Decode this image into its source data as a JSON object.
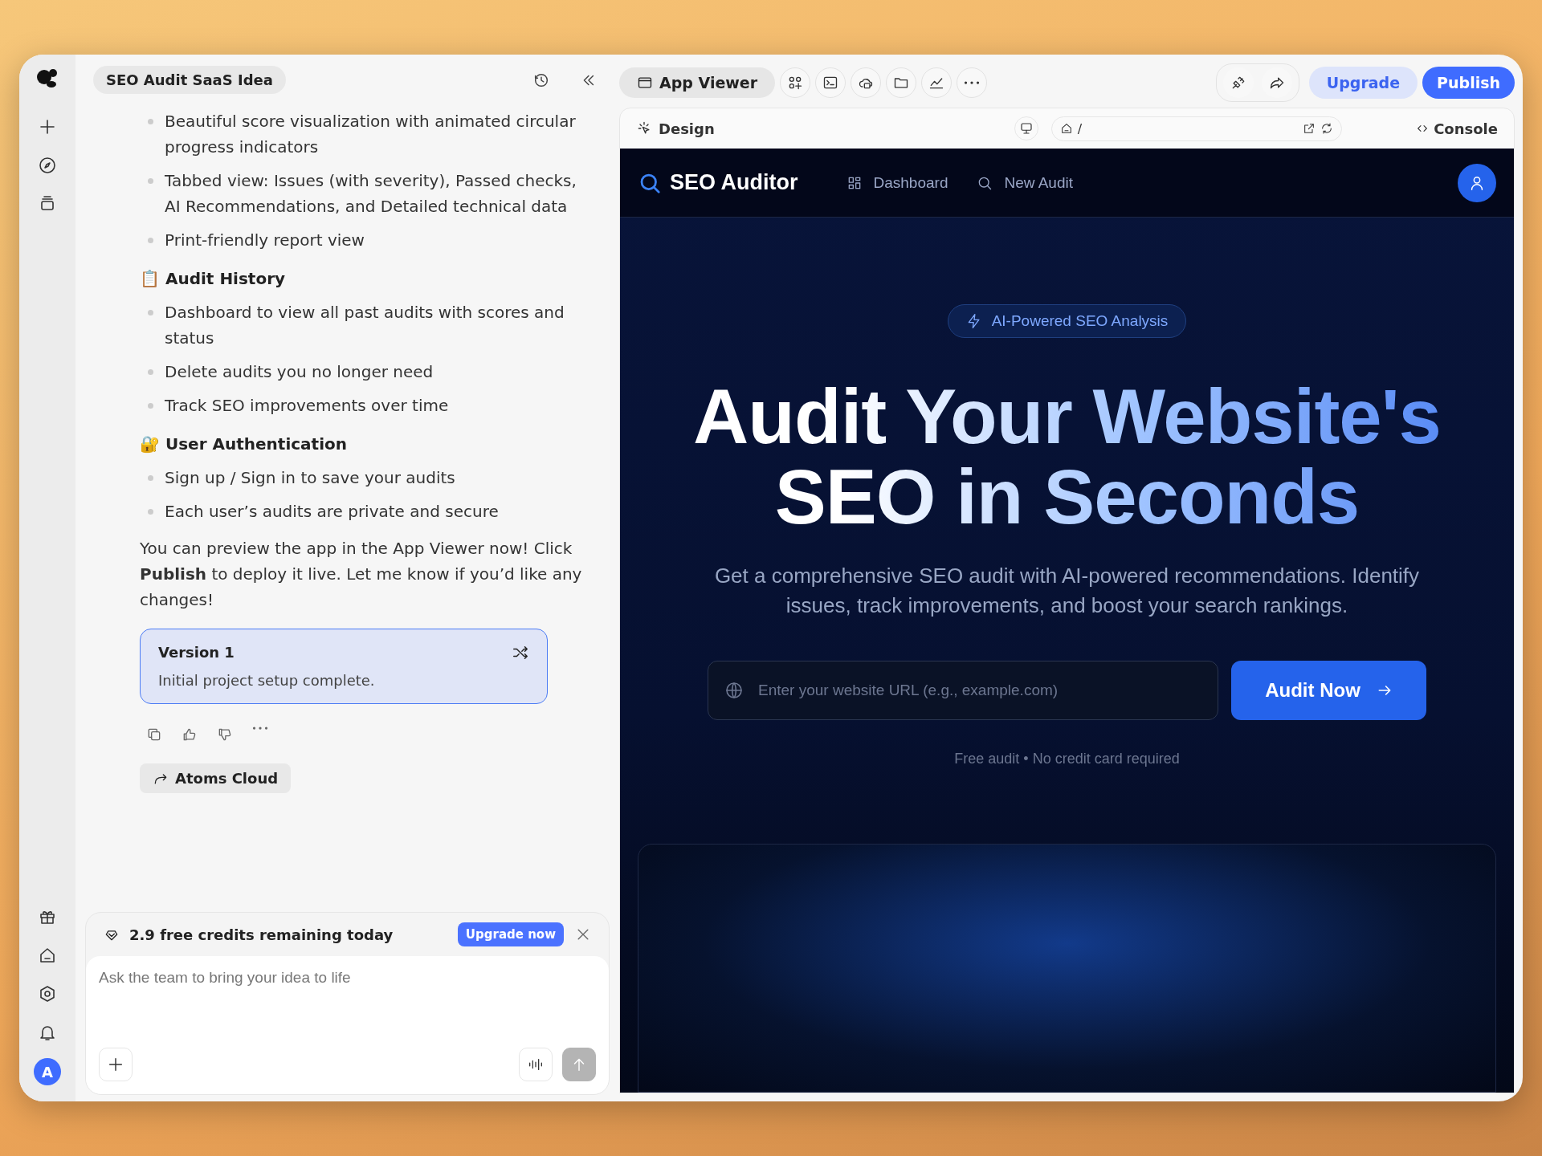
{
  "chat": {
    "title": "SEO Audit SaaS Idea",
    "blocks": [
      {
        "kind": "bullet",
        "text": "Beautiful score visualization with animated circular progress indicators"
      },
      {
        "kind": "bullet",
        "text": "Tabbed view: Issues (with severity), Passed checks, AI Recommendations, and Detailed technical data"
      },
      {
        "kind": "bullet",
        "text": "Print-friendly report view"
      },
      {
        "kind": "heading",
        "text": "📋 Audit History"
      },
      {
        "kind": "bullet",
        "text": "Dashboard to view all past audits with scores and status"
      },
      {
        "kind": "bullet",
        "text": "Delete audits you no longer need"
      },
      {
        "kind": "bullet",
        "text": "Track SEO improvements over time"
      },
      {
        "kind": "heading",
        "text": "🔐 User Authentication"
      },
      {
        "kind": "bullet",
        "text": "Sign up / Sign in to save your audits"
      },
      {
        "kind": "bullet",
        "text": "Each user’s audits are private and secure"
      },
      {
        "kind": "paragraph",
        "text": "You can preview the app in the App Viewer now! Click **Publish** to deploy it live. Let me know if you’d like any changes!"
      }
    ],
    "version_card": {
      "title": "Version 1",
      "description": "Initial project setup complete."
    },
    "cloud_button": "Atoms Cloud",
    "credits": {
      "text": "2.9 free credits remaining today",
      "button": "Upgrade now"
    },
    "composer": {
      "placeholder": "Ask the team to bring your idea to life"
    },
    "avatar": "A"
  },
  "toolbar": {
    "tab": "App Viewer",
    "upgrade": "Upgrade",
    "publish": "Publish"
  },
  "preview_bar": {
    "design": "Design",
    "path": "/",
    "console": "Console"
  },
  "app": {
    "brand": "SEO Auditor",
    "nav": [
      "Dashboard",
      "New Audit"
    ],
    "badge": "AI-Powered SEO Analysis",
    "headline": [
      "Audit Your Website's",
      "SEO in Seconds"
    ],
    "subtitle": "Get a comprehensive SEO audit with AI-powered recommendations. Identify issues, track improvements, and boost your search rankings.",
    "url_placeholder": "Enter your website URL (e.g., example.com)",
    "audit_button": "Audit Now",
    "note": "Free audit • No credit card required"
  }
}
